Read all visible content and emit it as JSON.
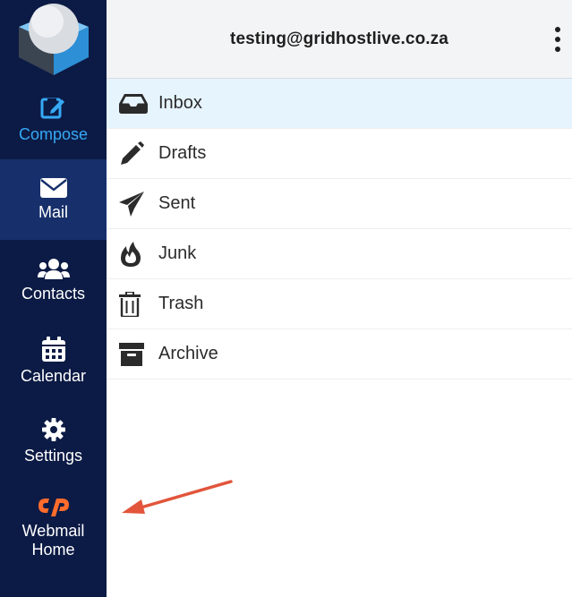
{
  "header": {
    "account": "testing@gridhostlive.co.za"
  },
  "sidebar": {
    "items": [
      {
        "key": "compose",
        "label": "Compose",
        "icon": "compose-icon",
        "active": false
      },
      {
        "key": "mail",
        "label": "Mail",
        "icon": "envelope-icon",
        "active": true
      },
      {
        "key": "contacts",
        "label": "Contacts",
        "icon": "users-icon",
        "active": false
      },
      {
        "key": "calendar",
        "label": "Calendar",
        "icon": "calendar-icon",
        "active": false
      },
      {
        "key": "settings",
        "label": "Settings",
        "icon": "gear-icon",
        "active": false
      },
      {
        "key": "webmail",
        "label": "Webmail\nHome",
        "icon": "cpanel-icon",
        "active": false
      }
    ]
  },
  "folders": [
    {
      "name": "Inbox",
      "icon": "inbox-icon",
      "selected": true
    },
    {
      "name": "Drafts",
      "icon": "pencil-icon",
      "selected": false
    },
    {
      "name": "Sent",
      "icon": "paper-plane-icon",
      "selected": false
    },
    {
      "name": "Junk",
      "icon": "fire-icon",
      "selected": false
    },
    {
      "name": "Trash",
      "icon": "trash-icon",
      "selected": false
    },
    {
      "name": "Archive",
      "icon": "archive-icon",
      "selected": false
    }
  ],
  "colors": {
    "sidebar_bg": "#0c1b45",
    "sidebar_active": "#17306b",
    "compose_accent": "#36a9f5",
    "cpanel_orange": "#ff6c2c",
    "selected_folder_bg": "#e6f4fe",
    "annotation_arrow": "#e2553b"
  }
}
